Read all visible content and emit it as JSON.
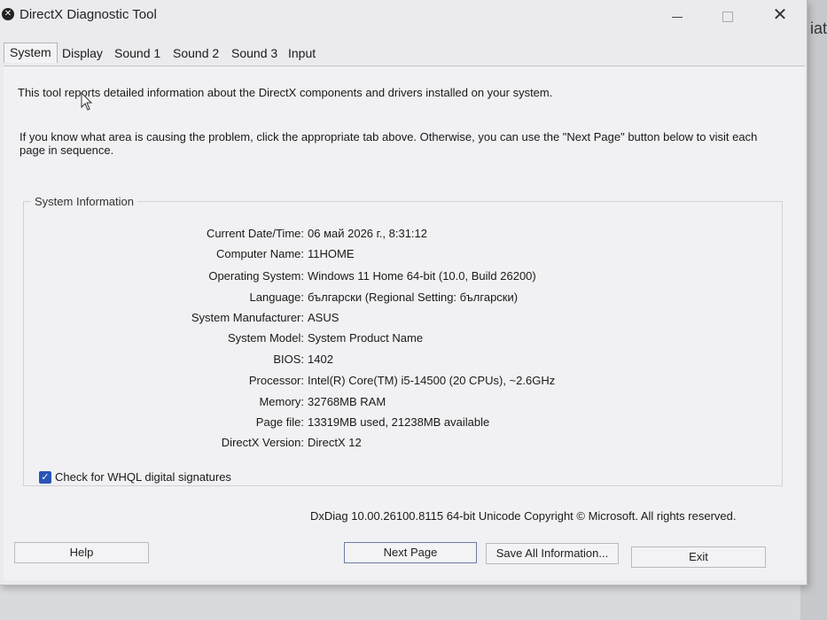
{
  "window": {
    "title": "DirectX Diagnostic Tool",
    "close_glyph": "✕",
    "icon_glyph": "✕"
  },
  "background": {
    "partial_text": "iat"
  },
  "tabs": [
    {
      "label": "System",
      "active": true
    },
    {
      "label": "Display"
    },
    {
      "label": "Sound 1"
    },
    {
      "label": "Sound 2"
    },
    {
      "label": "Sound 3"
    },
    {
      "label": "Input"
    }
  ],
  "intro": {
    "line1": "This tool reports detailed information about the DirectX components and drivers installed on your system.",
    "line2": "If you know what area is causing the problem, click the appropriate tab above.  Otherwise, you can use the \"Next Page\" button below to visit each page in sequence."
  },
  "system_info": {
    "title": "System Information",
    "rows": [
      {
        "label": "Current Date/Time:",
        "value": "06 май 2026 г., 8:31:12"
      },
      {
        "label": "Computer Name:",
        "value": "11HOME"
      },
      {
        "label": "Operating System:",
        "value": "Windows 11 Home 64-bit (10.0, Build 26200)"
      },
      {
        "label": "Language:",
        "value": "български (Regional Setting: български)"
      },
      {
        "label": "System Manufacturer:",
        "value": "ASUS"
      },
      {
        "label": "System Model:",
        "value": "System Product Name"
      },
      {
        "label": "BIOS:",
        "value": "1402"
      },
      {
        "label": "Processor:",
        "value": "Intel(R) Core(TM) i5-14500 (20 CPUs), ~2.6GHz"
      },
      {
        "label": "Memory:",
        "value": "32768MB RAM"
      },
      {
        "label": "Page file:",
        "value": "13319MB used, 21238MB available"
      },
      {
        "label": "DirectX Version:",
        "value": "DirectX 12"
      }
    ]
  },
  "whql": {
    "label": "Check for WHQL digital signatures",
    "checked": true,
    "check_glyph": "✓"
  },
  "footer": {
    "copyright": "DxDiag 10.00.26100.8115 64-bit Unicode  Copyright © Microsoft. All rights reserved."
  },
  "buttons": {
    "help": "Help",
    "next": "Next Page",
    "save": "Save All Information...",
    "exit": "Exit"
  },
  "colors": {
    "accent": "#2a55b5",
    "window_bg": "#ebebee"
  }
}
